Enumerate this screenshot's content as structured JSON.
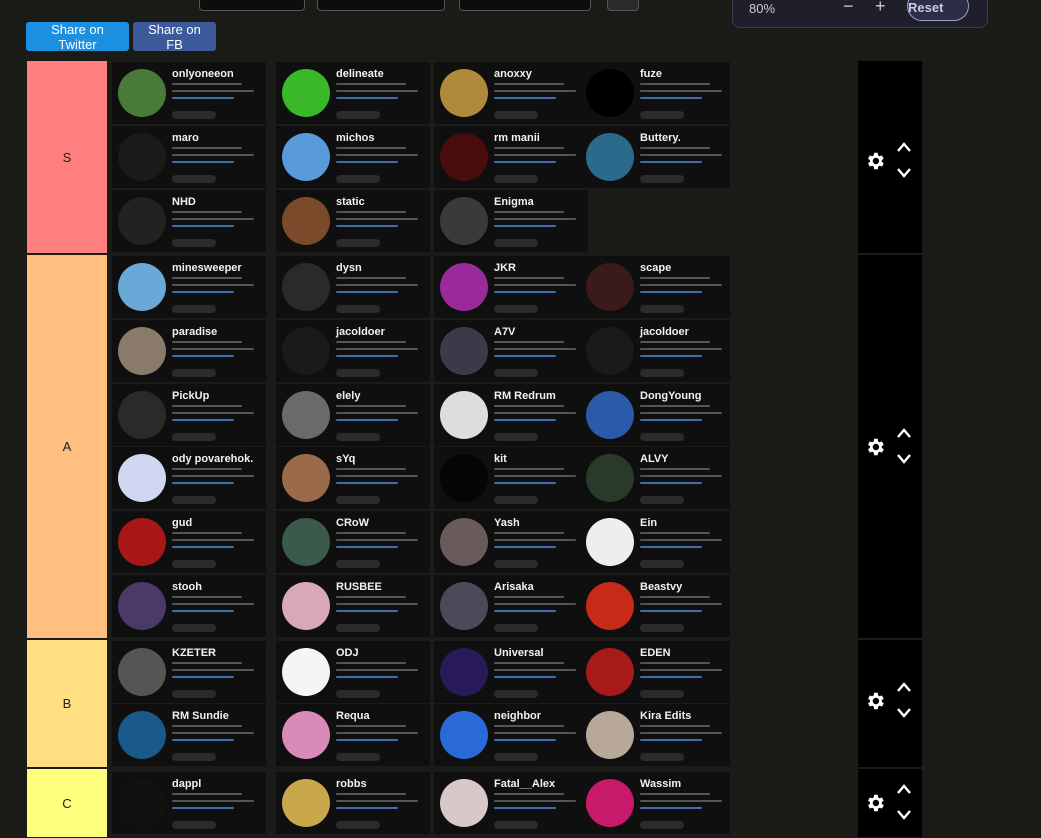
{
  "zoom": {
    "value": "80%",
    "minus": "−",
    "plus": "+",
    "reset_label": "Reset"
  },
  "share": {
    "twitter_label": "Share on Twitter",
    "fb_label": "Share on FB"
  },
  "tiers": [
    {
      "label": "S",
      "color": "#ff7f7f",
      "items": [
        {
          "name": "onlyoneeon",
          "avatar": "#4a7a3a"
        },
        {
          "name": "delineate",
          "avatar": "#39b92a"
        },
        {
          "name": "anoxxy",
          "avatar": "#b08a3a"
        },
        {
          "name": "fuze",
          "avatar": "#000000"
        },
        {
          "name": "maro",
          "avatar": "#1a1a1a"
        },
        {
          "name": "michos",
          "avatar": "#5a9ad8"
        },
        {
          "name": "rm manii",
          "avatar": "#4a0c0c"
        },
        {
          "name": "Buttery.",
          "avatar": "#2a6a8a"
        },
        {
          "name": "NHD",
          "avatar": "#222222"
        },
        {
          "name": "static",
          "avatar": "#7a4a2a"
        },
        {
          "name": "Enigma",
          "avatar": "#3a3a3a"
        }
      ]
    },
    {
      "label": "A",
      "color": "#ffbf7f",
      "items": [
        {
          "name": "minesweeper",
          "avatar": "#6aa8d8"
        },
        {
          "name": "dysn",
          "avatar": "#2a2a2a"
        },
        {
          "name": "JKR",
          "avatar": "#9a2a9a"
        },
        {
          "name": "scape",
          "avatar": "#3a1a1a"
        },
        {
          "name": "paradise",
          "avatar": "#8a7a6a"
        },
        {
          "name": "jacoldoer",
          "avatar": "#1a1a1a"
        },
        {
          "name": "A7V",
          "avatar": "#3a3a4a"
        },
        {
          "name": "jacoldoer",
          "avatar": "#1a1a1a"
        },
        {
          "name": "PickUp",
          "avatar": "#2a2a2a"
        },
        {
          "name": "elely",
          "avatar": "#6a6a6a"
        },
        {
          "name": "RM Redrum",
          "avatar": "#dddddd"
        },
        {
          "name": "DongYoung",
          "avatar": "#2a5aa8"
        },
        {
          "name": "ody povarehok.",
          "avatar": "#cfd8f0"
        },
        {
          "name": "sYq",
          "avatar": "#9a6a4a"
        },
        {
          "name": "kit",
          "avatar": "#050505"
        },
        {
          "name": "ALVY",
          "avatar": "#2a3a2a"
        },
        {
          "name": "gud",
          "avatar": "#a81818"
        },
        {
          "name": "CRoW",
          "avatar": "#3a5a4a"
        },
        {
          "name": "Yash",
          "avatar": "#6a5a5a"
        },
        {
          "name": "Ein",
          "avatar": "#eeeeee"
        },
        {
          "name": "stooh",
          "avatar": "#4a3a6a"
        },
        {
          "name": "RUSBEE",
          "avatar": "#d8a8b8"
        },
        {
          "name": "Arisaka",
          "avatar": "#4a4a5a"
        },
        {
          "name": "Beastvy",
          "avatar": "#c82a1a"
        }
      ]
    },
    {
      "label": "B",
      "color": "#ffdf7f",
      "items": [
        {
          "name": "KZETER",
          "avatar": "#555555"
        },
        {
          "name": "ODJ",
          "avatar": "#f5f5f5"
        },
        {
          "name": "Universal",
          "avatar": "#2a1a5a"
        },
        {
          "name": "EDEN",
          "avatar": "#a81a1a"
        },
        {
          "name": "RM Sundie",
          "avatar": "#1a5a8a"
        },
        {
          "name": "Requa",
          "avatar": "#d88ab8"
        },
        {
          "name": "neighbor",
          "avatar": "#2a6ad8"
        },
        {
          "name": "Kira Edits",
          "avatar": "#b8a898"
        }
      ]
    },
    {
      "label": "C",
      "color": "#ffff7f",
      "items": [
        {
          "name": "dappl",
          "avatar": "#111111"
        },
        {
          "name": "robbs",
          "avatar": "#c8a84a"
        },
        {
          "name": "Fatal__Alex",
          "avatar": "#d8c8c8"
        },
        {
          "name": "Wassim",
          "avatar": "#c81a6a"
        }
      ]
    }
  ]
}
